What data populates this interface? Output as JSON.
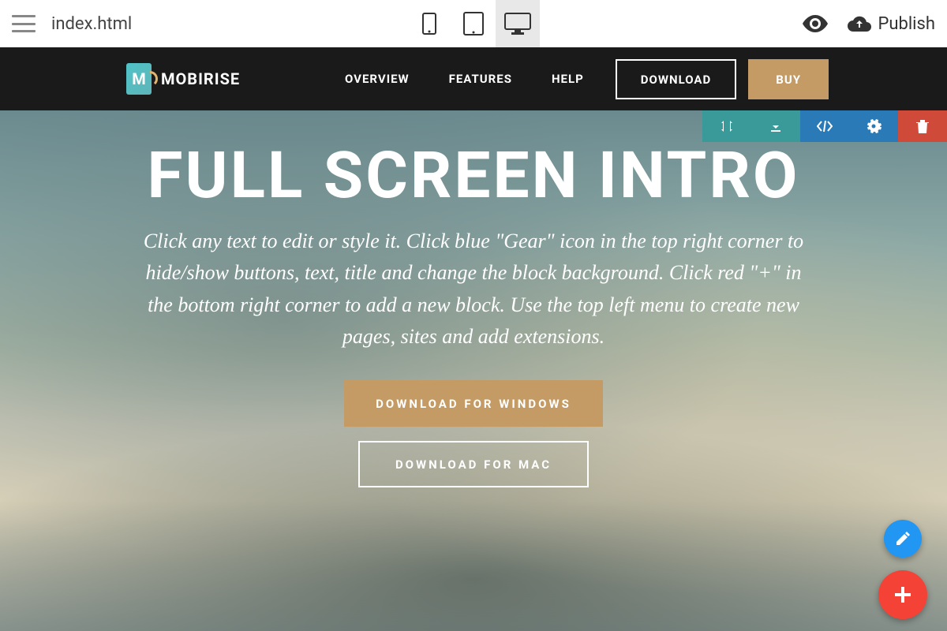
{
  "toolbar": {
    "filename": "index.html",
    "publish_label": "Publish"
  },
  "site_header": {
    "brand": "MOBIRISE",
    "nav": [
      "OVERVIEW",
      "FEATURES",
      "HELP"
    ],
    "download": "DOWNLOAD",
    "buy": "BUY"
  },
  "hero": {
    "title": "FULL SCREEN INTRO",
    "subtitle": "Click any text to edit or style it. Click blue \"Gear\" icon in the top right corner to hide/show buttons, text, title and change the block background. Click red \"+\" in the bottom right corner to add a new block. Use the top left menu to create new pages, sites and add extensions.",
    "btn_windows": "DOWNLOAD FOR WINDOWS",
    "btn_mac": "DOWNLOAD FOR MAC"
  }
}
